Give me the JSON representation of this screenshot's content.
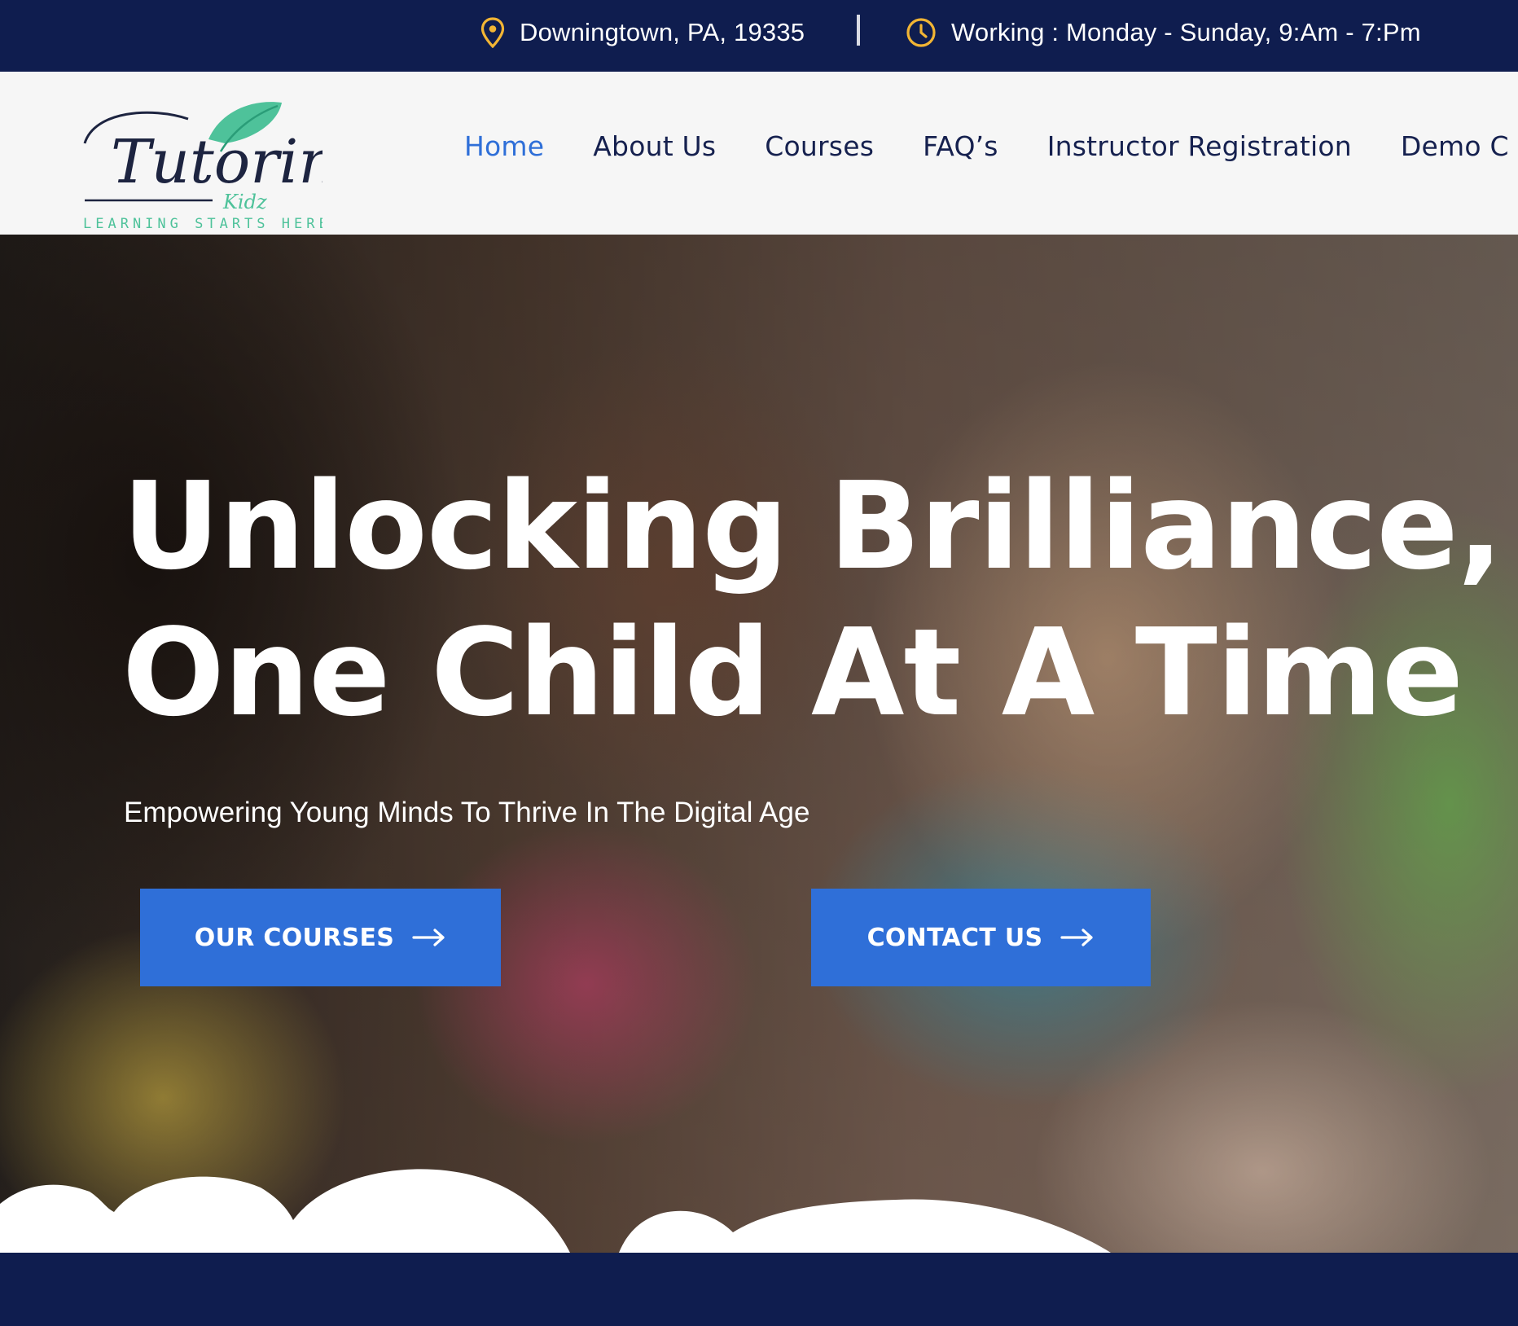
{
  "topbar": {
    "location": "Downingtown, PA, 19335",
    "hours": "Working : Monday - Sunday, 9:Am - 7:Pm",
    "location_icon": "map-pin-icon",
    "hours_icon": "clock-icon"
  },
  "logo": {
    "title": "Tutoring",
    "subtitle": "Kidz",
    "tagline": "LEARNING STARTS HERE"
  },
  "nav": {
    "items": [
      {
        "label": "Home",
        "active": true
      },
      {
        "label": "About Us"
      },
      {
        "label": "Courses"
      },
      {
        "label": "FAQ’s"
      },
      {
        "label": "Instructor Registration"
      },
      {
        "label": "Demo C"
      }
    ]
  },
  "hero": {
    "title_line1": "Unlocking Brilliance,",
    "title_line2": "One Child At A Time",
    "subtitle": "Empowering Young Minds To Thrive In The Digital Age",
    "btn_courses": "OUR COURSES",
    "btn_contact": "CONTACT US"
  },
  "colors": {
    "navy": "#0f1d4f",
    "accent": "#2f6fd8",
    "icon_yellow": "#f2b534",
    "logo_green": "#4ec29a"
  }
}
